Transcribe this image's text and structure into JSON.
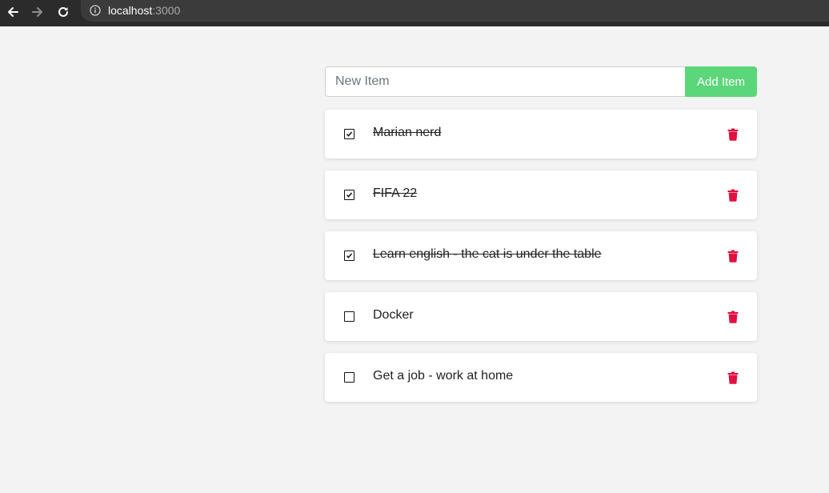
{
  "browser": {
    "url_host": "localhost",
    "url_port": ":3000",
    "back_icon": "arrow-left-icon",
    "forward_icon": "arrow-right-icon",
    "reload_icon": "reload-icon",
    "info_icon": "info-icon"
  },
  "form": {
    "placeholder": "New Item",
    "value": "",
    "add_label": "Add Item"
  },
  "todos": [
    {
      "label": "Marian nerd",
      "checked": true
    },
    {
      "label": "FIFA 22",
      "checked": true
    },
    {
      "label": "Learn english - the cat is under the table",
      "checked": true
    },
    {
      "label": "Docker",
      "checked": false
    },
    {
      "label": "Get a job - work at home",
      "checked": false
    }
  ],
  "colors": {
    "accent_green": "#5cd67a",
    "delete_red": "#e0113f",
    "background": "#f3f3f3"
  }
}
